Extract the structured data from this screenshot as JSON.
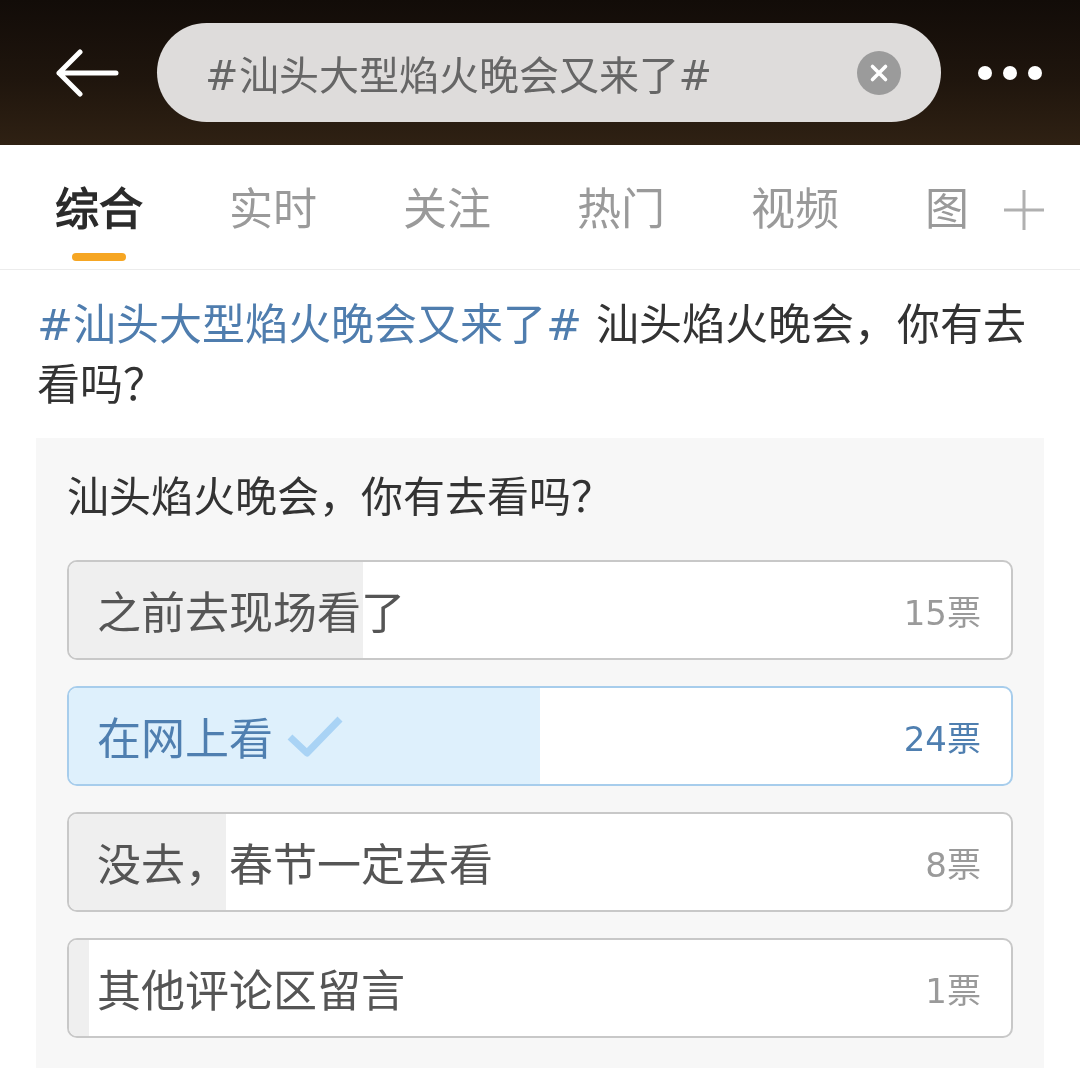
{
  "top_bar": {
    "search_field": {
      "value": "#汕头大型焰火晚会又来了#"
    }
  },
  "tabs": [
    {
      "label": "综合",
      "selected": true
    },
    {
      "label": "实时",
      "selected": false
    },
    {
      "label": "关注",
      "selected": false
    },
    {
      "label": "热门",
      "selected": false
    },
    {
      "label": "视频",
      "selected": false
    },
    {
      "label": "图",
      "selected": false
    }
  ],
  "post": {
    "hashtag": "#汕头大型焰火晚会又来了#",
    "text": "汕头焰火晚会，你有去看吗？"
  },
  "poll": {
    "question": "汕头焰火晚会，你有去看吗？",
    "options": [
      {
        "label": "之前去现场看了",
        "votes": "15票",
        "level": 0.3125,
        "selected": false
      },
      {
        "label": "在网上看",
        "votes": "24票",
        "level": 0.5,
        "selected": true
      },
      {
        "label": "没去，春节一定去看",
        "votes": "8票",
        "level": 0.1667,
        "selected": false
      },
      {
        "label": "其他评论区留言",
        "votes": "1票",
        "level": 0.0208,
        "selected": false
      }
    ]
  }
}
